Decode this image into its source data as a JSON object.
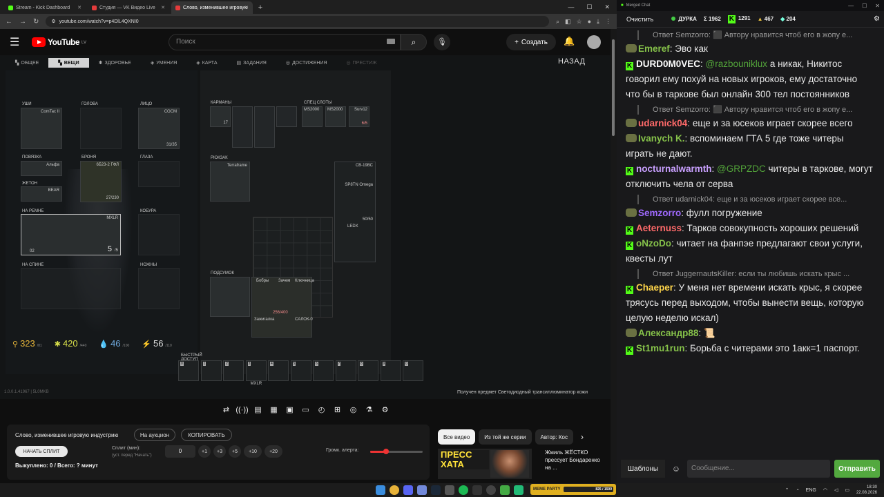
{
  "browser": {
    "tabs": [
      {
        "title": "Stream - Kick Dashboard",
        "color": "#53fc18"
      },
      {
        "title": "Студия — VK Видео Live",
        "color": "#e33b3b"
      },
      {
        "title": "Слово, изменившее игровую",
        "color": "#e33b3b"
      }
    ],
    "url": "youtube.com/watch?v=p4DlL4QXNI0"
  },
  "youtube": {
    "logo": "YouTube",
    "region": "LV",
    "search_placeholder": "Поиск",
    "create_label": "Создать"
  },
  "game": {
    "tabs": [
      "ОБЩЕЕ",
      "ВЕЩИ",
      "ЗДОРОВЬЕ",
      "УМЕНИЯ",
      "КАРТА",
      "ЗАДАНИЯ",
      "ДОСТИЖЕНИЯ",
      "ПРЕСТИЖ"
    ],
    "active_tab": "ВЕЩИ",
    "back": "НАЗАД",
    "slot_labels": {
      "ears": "УШИ",
      "head": "ГОЛОВА",
      "face": "ЛИЦО",
      "armband": "ПОВЯЗКА",
      "armor": "БРОНЯ",
      "eyes": "ГЛАЗА",
      "token": "ЖЕТОН",
      "sling": "НА РЕМНЕ",
      "holster": "КОБУРА",
      "back": "НА СПИНЕ",
      "melee": "НОЖНЫ",
      "pockets": "КАРМАНЫ",
      "special": "СПЕЦ СЛОТЫ",
      "backpack": "РЮКЗАК",
      "pouch": "ПОДСУМОК",
      "quick": "БЫСТРЫЙ ДОСТУП"
    },
    "item_texts": {
      "comtac": "ComTac II",
      "face_name": "СОСМ",
      "face_dur": "31/35",
      "armband": "Альфа",
      "armor": "6Б23-2 ГФЛ",
      "armor_dur": "27/230",
      "token": "BEAR",
      "weapon": "MXLR",
      "weapon_ammo": "5",
      "weapon_ammo_max": "/5",
      "weapon_num": "02",
      "backpack": "Terraframe",
      "rig_top": "СВ-19ВС",
      "rig_mid": "SP8TN Omega",
      "rig_dur": "50/50",
      "special": [
        "MS2000",
        "MS2000",
        "Surv12"
      ],
      "surv_dur": "6/5",
      "pouch_items": [
        "Бобры",
        "Зачем",
        "Ключница",
        "Зажигалка",
        "САЛОК-0"
      ],
      "pouch_dur": "256/400",
      "pocket_17": "17",
      "ledx": "LEDX",
      "quick_item": "MXLR"
    },
    "stats": [
      {
        "value": "323",
        "max": "/81",
        "color": "#e6b53a"
      },
      {
        "value": "420",
        "max": "/440",
        "color": "#d9e04a"
      },
      {
        "value": "46",
        "max": "/100",
        "color": "#6fa8dc"
      },
      {
        "value": "56",
        "max": "/110",
        "color": "#eeeeee"
      }
    ],
    "version": "1.0.0.1.41967 | 5L0MKB",
    "received": "Получен предмет Светодиодный трансиллюминатор кожи",
    "quick_slots": [
      "0",
      "1",
      "2",
      "3",
      "4",
      "5",
      "6",
      "7",
      "8",
      "9",
      "0"
    ]
  },
  "player_controls": [
    "⇄",
    "((·))",
    "▤",
    "▦",
    "▣",
    "▭",
    "◴",
    "⊞",
    "◎",
    "⚗",
    "⚙"
  ],
  "widget": {
    "title": "Слово, изменившее игровую индустрию",
    "auction": "На аукцион",
    "copy": "КОПИРОВАТЬ",
    "start": "НАЧАТЬ СПЛИТ",
    "split_label": "Сплит (мин):",
    "split_hint": "(уст. перед \"Начать\")",
    "split_value": "0",
    "increments": [
      "+1",
      "+3",
      "+5",
      "+10",
      "+20"
    ],
    "volume_label": "Громк. алерта:",
    "volume": 0.3,
    "bought": "Выкуплено: 0 / Всего: ? минут"
  },
  "related": {
    "chips": [
      "Все видео",
      "Из той же серии",
      "Автор: Кос"
    ],
    "thumb_text": "ПРЕСС ХАТА",
    "title": "Жмиль ЖЁСТКО прессует Бондаренко на ..."
  },
  "chat": {
    "window_title": "Merged Chat",
    "clear": "Очистить",
    "stats": [
      {
        "icon": "●",
        "label": "ДУРКА"
      },
      {
        "icon": "Σ",
        "label": "1962"
      },
      {
        "icon": "K",
        "label": "1291"
      },
      {
        "icon": "▲",
        "label": "467"
      },
      {
        "icon": "◆",
        "label": "204"
      }
    ],
    "messages": [
      {
        "reply": "Ответ Semzorro: ⬛ Автору нравится чтоб его в жопу е...",
        "user": "",
        "color": "",
        "text": ""
      },
      {
        "badge": "emo",
        "user": "Emeref",
        "color": "#86c24a",
        "text": "Эво как"
      },
      {
        "badge": "kick",
        "user": "DURD0M0VEC",
        "color": "#ffffff",
        "mention": "@razbouniklux",
        "text": "а никак, Никитос говорил ему похуй на новых игроков, ему достаточно что бы в таркове был онлайн 300 тел постоянников"
      },
      {
        "reply": "Ответ Semzorro: ⬛ Автору нравится чтоб его в жопу е..."
      },
      {
        "badge": "emo",
        "user": "udarnick04",
        "color": "#ff6a6a",
        "text": "еще и за юсеков играет скорее всего"
      },
      {
        "badge": "emo",
        "user": "Ivanych K.",
        "color": "#86c24a",
        "text": "вспоминаем ГТА 5 где тоже читеры играть не дают."
      },
      {
        "badge": "kick",
        "user": "nocturnalwarmth",
        "color": "#c9a0ff",
        "mention": "@GRPZDC",
        "text": "читеры в таркове, могут отключить чела от серва"
      },
      {
        "reply": "Ответ udarnick04: еще и за юсеков играет скорее все..."
      },
      {
        "badge": "emo",
        "user": "Semzorro",
        "color": "#a06aff",
        "text": "фулл погружение"
      },
      {
        "badge": "kick",
        "user": "Aeternuss",
        "color": "#ff6a6a",
        "text": "Тарков совокупность хороших решений"
      },
      {
        "badge": "kick",
        "user": "oNzoDo",
        "color": "#86c24a",
        "text": "читает на фанпэе предлагают свои услуги, квесты лут"
      },
      {
        "reply": "Ответ JuggernautsKiller: если ты любишь искать крыс ..."
      },
      {
        "badge": "kick",
        "user": "Chaeper",
        "color": "#ffd54a",
        "text": "У меня нет времени искать крыс, я скорее трясусь перед выходом, чтобы вынести вещь, которую целую неделю искал)"
      },
      {
        "badge": "emo",
        "user": "Александр88",
        "color": "#86c24a",
        "text": "📜"
      },
      {
        "badge": "kick",
        "user": "St1mu1run",
        "color": "#86c24a",
        "text": "Борьба с читерами это 1акк=1 паспорт."
      }
    ],
    "templates": "Шаблоны",
    "input_placeholder": "Сообщение...",
    "send": "Отправить"
  },
  "taskbar": {
    "lang": "ENG",
    "time": "18:30",
    "date": "22.08.2026",
    "goal_label": "MEME PARTY",
    "goal_value": "825 / 1500"
  }
}
